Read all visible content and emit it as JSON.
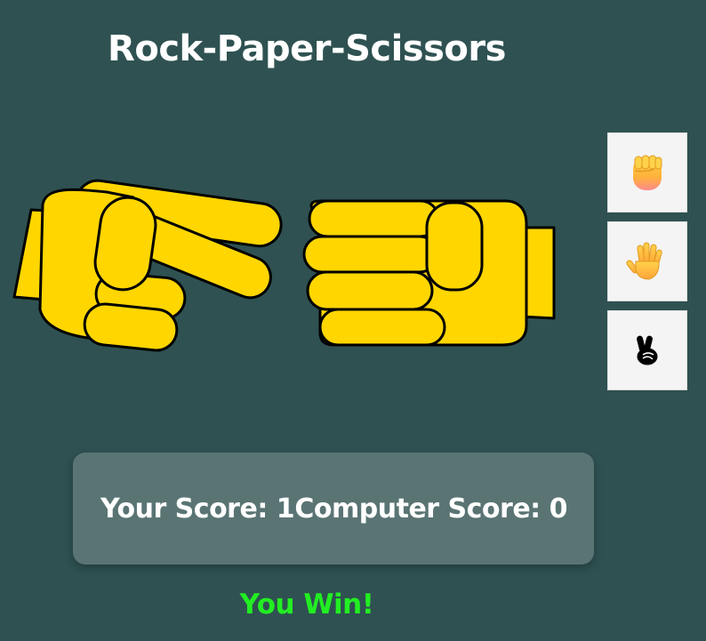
{
  "game": {
    "title": "Rock-Paper-Scissors"
  },
  "hands": {
    "player": {
      "choice": "scissors",
      "icon": "scissors-hand-icon"
    },
    "computer": {
      "choice": "paper",
      "icon": "paper-hand-icon"
    },
    "color": "#ffd600"
  },
  "choices": [
    {
      "name": "rock",
      "icon": "raised-fist-icon"
    },
    {
      "name": "paper",
      "icon": "raised-hand-icon"
    },
    {
      "name": "scissors",
      "icon": "victory-hand-icon"
    }
  ],
  "score": {
    "player_label": "Your Score: 1",
    "computer_label": "Computer Score: 0",
    "player": 1,
    "computer": 0
  },
  "result": {
    "text": "You Win!",
    "color": "#22ee22"
  },
  "colors": {
    "background": "#2f5151",
    "scoreboard": "#5a7474",
    "hand": "#ffd600"
  }
}
